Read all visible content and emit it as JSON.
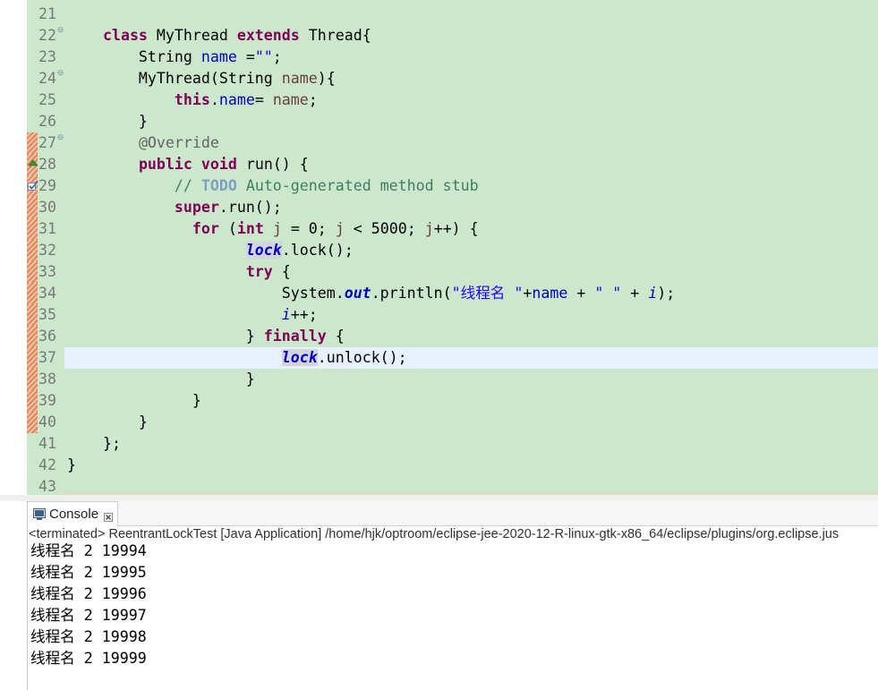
{
  "colors": {
    "editor_background": "#cbe8cd",
    "current_line_highlight": "#e8f2fe",
    "occurrence_highlight": "#d4d4dc"
  },
  "editor": {
    "lines": [
      {
        "n": 21,
        "tokens": []
      },
      {
        "n": 22,
        "fold": true,
        "tokens": [
          {
            "t": "    "
          },
          {
            "t": "class",
            "k": "kw"
          },
          {
            "t": " MyThread "
          },
          {
            "t": "extends",
            "k": "kw"
          },
          {
            "t": " Thread{"
          }
        ]
      },
      {
        "n": 23,
        "tokens": [
          {
            "t": "        String "
          },
          {
            "t": "name",
            "k": "field"
          },
          {
            "t": " ="
          },
          {
            "t": "\"\"",
            "k": "string"
          },
          {
            "t": ";"
          }
        ]
      },
      {
        "n": 24,
        "fold": true,
        "tokens": [
          {
            "t": "        MyThread(String "
          },
          {
            "t": "name",
            "k": "param"
          },
          {
            "t": "){"
          }
        ]
      },
      {
        "n": 25,
        "tokens": [
          {
            "t": "            "
          },
          {
            "t": "this",
            "k": "kw"
          },
          {
            "t": "."
          },
          {
            "t": "name",
            "k": "field"
          },
          {
            "t": "= "
          },
          {
            "t": "name",
            "k": "param"
          },
          {
            "t": ";"
          }
        ]
      },
      {
        "n": 26,
        "tokens": [
          {
            "t": "        }"
          }
        ]
      },
      {
        "n": 27,
        "fold": true,
        "changed": true,
        "tokens": [
          {
            "t": "        "
          },
          {
            "t": "@Override",
            "k": "annotation"
          }
        ]
      },
      {
        "n": 28,
        "changed": true,
        "marker": "override-indicator-icon",
        "tokens": [
          {
            "t": "        "
          },
          {
            "t": "public",
            "k": "kw"
          },
          {
            "t": " "
          },
          {
            "t": "void",
            "k": "kw"
          },
          {
            "t": " run() {"
          }
        ]
      },
      {
        "n": 29,
        "changed": true,
        "marker": "task-icon",
        "tokens": [
          {
            "t": "            "
          },
          {
            "t": "// ",
            "k": "comment"
          },
          {
            "t": "TODO",
            "k": "todo"
          },
          {
            "t": " Auto-generated method stub",
            "k": "comment"
          }
        ]
      },
      {
        "n": 30,
        "changed": true,
        "tokens": [
          {
            "t": "            "
          },
          {
            "t": "super",
            "k": "kw"
          },
          {
            "t": ".run();"
          }
        ]
      },
      {
        "n": 31,
        "changed": true,
        "tokens": [
          {
            "t": "              "
          },
          {
            "t": "for",
            "k": "kw"
          },
          {
            "t": " ("
          },
          {
            "t": "int",
            "k": "kw"
          },
          {
            "t": " "
          },
          {
            "t": "j",
            "k": "local"
          },
          {
            "t": " = 0; "
          },
          {
            "t": "j",
            "k": "local"
          },
          {
            "t": " < 5000; "
          },
          {
            "t": "j",
            "k": "local"
          },
          {
            "t": "++) {"
          }
        ]
      },
      {
        "n": 32,
        "changed": true,
        "tokens": [
          {
            "t": "                    "
          },
          {
            "t": "lock",
            "k": "static-final",
            "occ": true
          },
          {
            "t": ".lock();"
          }
        ]
      },
      {
        "n": 33,
        "changed": true,
        "tokens": [
          {
            "t": "                    "
          },
          {
            "t": "try",
            "k": "kw"
          },
          {
            "t": " {"
          }
        ]
      },
      {
        "n": 34,
        "changed": true,
        "tokens": [
          {
            "t": "                        System."
          },
          {
            "t": "out",
            "k": "static-final"
          },
          {
            "t": ".println("
          },
          {
            "t": "\"线程名 \"",
            "k": "string"
          },
          {
            "t": "+"
          },
          {
            "t": "name",
            "k": "field"
          },
          {
            "t": " + "
          },
          {
            "t": "\" \"",
            "k": "string"
          },
          {
            "t": " + "
          },
          {
            "t": "i",
            "k": "static"
          },
          {
            "t": ");"
          }
        ]
      },
      {
        "n": 35,
        "changed": true,
        "tokens": [
          {
            "t": "                        "
          },
          {
            "t": "i",
            "k": "static"
          },
          {
            "t": "++;"
          }
        ]
      },
      {
        "n": 36,
        "changed": true,
        "tokens": [
          {
            "t": "                    } "
          },
          {
            "t": "finally",
            "k": "kw"
          },
          {
            "t": " {"
          }
        ]
      },
      {
        "n": 37,
        "changed": true,
        "current": true,
        "tokens": [
          {
            "t": "                        "
          },
          {
            "t": "lock",
            "k": "static-final",
            "occ": true
          },
          {
            "t": ".unlock();"
          }
        ]
      },
      {
        "n": 38,
        "changed": true,
        "tokens": [
          {
            "t": "                    }"
          }
        ]
      },
      {
        "n": 39,
        "changed": true,
        "tokens": [
          {
            "t": "              }"
          }
        ]
      },
      {
        "n": 40,
        "changed": true,
        "tokens": [
          {
            "t": "        }"
          }
        ]
      },
      {
        "n": 41,
        "tokens": [
          {
            "t": "    };"
          }
        ]
      },
      {
        "n": 42,
        "tokens": [
          {
            "t": "}"
          }
        ]
      },
      {
        "n": 43,
        "tokens": []
      }
    ]
  },
  "console": {
    "tab_icon": "console-icon",
    "tab_label": "Console",
    "close_icon": "close-icon",
    "description": "<terminated> ReentrantLockTest [Java Application] /home/hjk/optroom/eclipse-jee-2020-12-R-linux-gtk-x86_64/eclipse/plugins/org.eclipse.jus",
    "output": [
      "线程名 2 19994",
      "线程名 2 19995",
      "线程名 2 19996",
      "线程名 2 19997",
      "线程名 2 19998",
      "线程名 2 19999"
    ]
  }
}
